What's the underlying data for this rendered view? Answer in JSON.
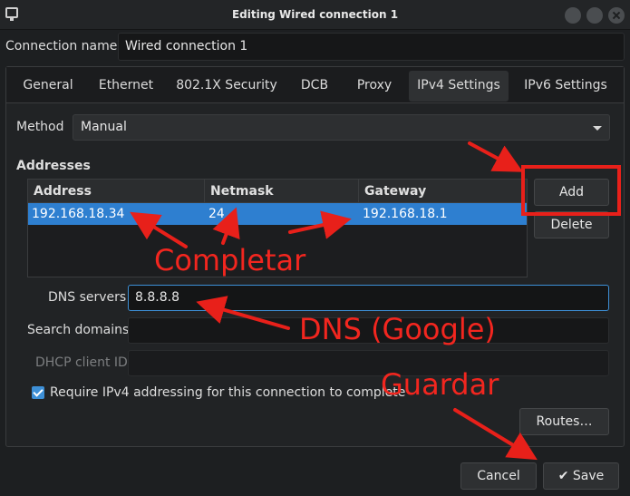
{
  "window": {
    "title": "Editing Wired connection 1"
  },
  "connection": {
    "name_label": "Connection name",
    "name_value": "Wired connection 1"
  },
  "tabs": [
    {
      "label": "General"
    },
    {
      "label": "Ethernet"
    },
    {
      "label": "802.1X Security"
    },
    {
      "label": "DCB"
    },
    {
      "label": "Proxy"
    },
    {
      "label": "IPv4 Settings",
      "active": true
    },
    {
      "label": "IPv6 Settings"
    }
  ],
  "method": {
    "label": "Method",
    "value": "Manual"
  },
  "addresses": {
    "label": "Addresses",
    "columns": [
      "Address",
      "Netmask",
      "Gateway"
    ],
    "rows": [
      {
        "address": "192.168.18.34",
        "netmask": "24",
        "gateway": "192.168.18.1"
      }
    ],
    "add_label": "Add",
    "delete_label": "Delete"
  },
  "dns": {
    "label": "DNS servers",
    "value": "8.8.8.8"
  },
  "search_domains": {
    "label": "Search domains",
    "value": ""
  },
  "dhcp_client_id": {
    "label": "DHCP client ID",
    "value": ""
  },
  "require_ipv4": {
    "label": "Require IPv4 addressing for this connection to complete",
    "checked": true
  },
  "routes_label": "Routes…",
  "footer": {
    "cancel_label": "Cancel",
    "save_label": "Save",
    "save_icon": "✔"
  },
  "annotations": {
    "completar": "Completar",
    "dns": "DNS (Google)",
    "guardar": "Guardar",
    "color": "#f2261f"
  },
  "colors": {
    "accent": "#3d8fd6",
    "selection": "#2e7fd0"
  }
}
